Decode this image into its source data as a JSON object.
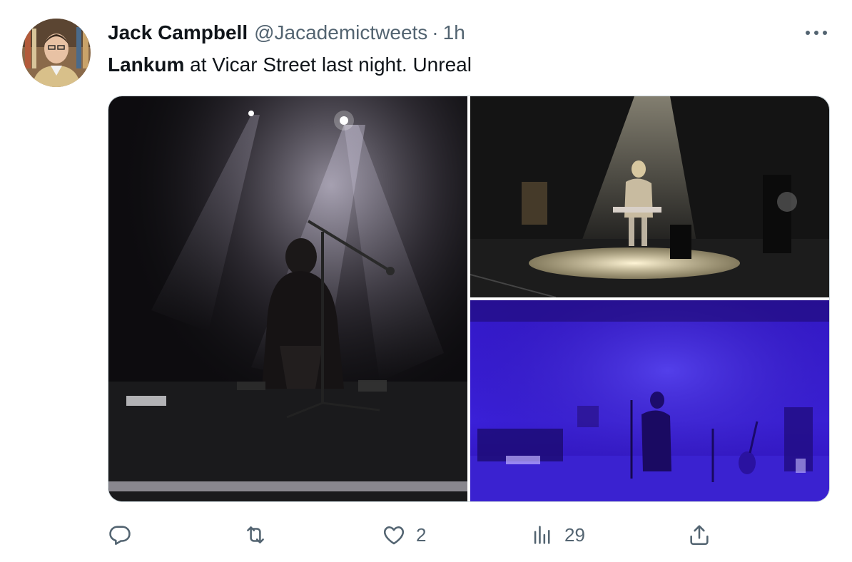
{
  "author": {
    "name": "Jack Campbell",
    "handle": "@Jacademictweets",
    "separator": "·",
    "time": "1h"
  },
  "tweet": {
    "mention": "Lankum",
    "text": " at Vicar Street last night. Unreal"
  },
  "media": {
    "count": 3
  },
  "actions": {
    "reply_count": "",
    "retweet_count": "",
    "like_count": "2",
    "views_count": "29"
  },
  "colors": {
    "text_primary": "#0f1419",
    "text_secondary": "#536471",
    "border": "#cfd9de",
    "stage_blue": "#3a1fd6"
  },
  "icons": [
    "more-icon",
    "reply-icon",
    "retweet-icon",
    "like-icon",
    "views-icon",
    "share-icon"
  ]
}
